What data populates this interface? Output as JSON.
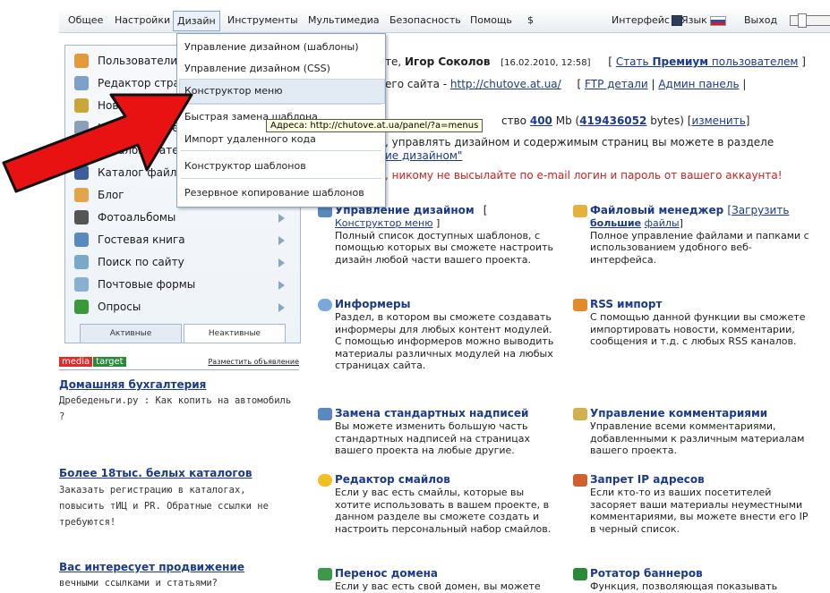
{
  "menubar": {
    "items": [
      "Общее",
      "Настройки",
      "Дизайн",
      "Инструменты",
      "Мультимедиа",
      "Безопасность",
      "Помощь",
      "$"
    ],
    "right": {
      "interface": "Интерфейс",
      "language": "Язык",
      "exit": "Выход"
    }
  },
  "dropdown": {
    "items": [
      "Управление дизайном (шаблоны)",
      "Управление дизайном (CSS)",
      "Конструктор меню",
      "Быстрая замена шаблона",
      "Импорт удаленного кода",
      "Конструктор шаблонов",
      "Резервное копирование шаблонов"
    ],
    "tooltip": "Адреса: http://chutove.at.ua/panel/?a=menus"
  },
  "sidebar": {
    "items": [
      {
        "label": "Пользователи",
        "icon": "users-icon",
        "color": "#e49a3a"
      },
      {
        "label": "Редактор страниц",
        "icon": "page-editor-icon",
        "color": "#7da0c8"
      },
      {
        "label": "Новости",
        "icon": "news-icon",
        "color": "#c9a53a"
      },
      {
        "label": "Каталог статей",
        "icon": "articles-icon",
        "color": "#8aa0b8"
      },
      {
        "label": "Каталог статей",
        "icon": "catalog-icon",
        "color": "#7ea0c4"
      },
      {
        "label": "Каталог файлов",
        "icon": "save-icon",
        "color": "#3a5f9a"
      },
      {
        "label": "Блог",
        "icon": "blog-icon",
        "color": "#e3a54a"
      },
      {
        "label": "Фотоальбомы",
        "icon": "camera-icon",
        "color": "#555555"
      },
      {
        "label": "Гостевая книга",
        "icon": "book-icon",
        "color": "#5a89c0"
      },
      {
        "label": "Поиск по сайту",
        "icon": "search-icon",
        "color": "#7aa8c8"
      },
      {
        "label": "Почтовые формы",
        "icon": "mail-icon",
        "color": "#8ab0d0"
      },
      {
        "label": "Опросы",
        "icon": "chart-icon",
        "color": "#3a9a3a"
      }
    ],
    "tabs": {
      "active": "Активные",
      "inactive": "Неактивные"
    }
  },
  "ad": {
    "brand1": "media",
    "brand2": "target",
    "place": "Разместить объявление",
    "blocks": [
      {
        "title": "Домашняя бухгалтерия",
        "text": "Дребеденьги.ру : Как копить на автомобиль ?"
      },
      {
        "title": "Более 18тыс. белых каталогов",
        "text": "Заказать регистрацию в каталогах, повысить тИЦ и PR. Обратные ссылки не требуются!"
      },
      {
        "title": "Вас интересует продвижение",
        "text": "вечными ссылками и статьями?"
      }
    ]
  },
  "welcome": {
    "greet": "те,",
    "name": "Игор Соколов",
    "datetime": "[16.02.2010, 12:58]",
    "premium_pre": "[",
    "premium_link1": "Стать",
    "premium_link2": "Премиум",
    "premium_link3": "пользователем",
    "premium_post": "]",
    "site_pre": "его сайта - ",
    "site_url": "http://chutove.at.ua/",
    "ftp_link": "FTP детали",
    "sep": "|",
    "admin_link": "Админ панель",
    "storage_pre": "ство",
    "storage_mb": "400",
    "storage_unit": "Mb (",
    "storage_bytes": "419436052",
    "storage_bytes_unit": "bytes)",
    "storage_change": "изменить",
    "design_line1": ", управлять дизайном и содержимым страниц вы можете в разделе",
    "design_line2": "ие дизайном\"",
    "warning": ", никому не высылайте по e-mail логин и пароль от вашего аккаунта!"
  },
  "sections": [
    {
      "title": "Управление дизайном",
      "extra": "[",
      "link": "Конструктор меню",
      "close": "]",
      "desc": "Полный список доступных шаблонов, с помощью которых вы сможете настроить дизайн любой части вашего проекта.",
      "icon": "design-icon",
      "color": "#5a89c0"
    },
    {
      "title": "Файловый менеджер",
      "extra": "[",
      "link": "Загрузить",
      "link2": "большие",
      "link3": "файлы",
      "close": "]",
      "desc": "Полное управление файлами и папками с использованием удобного веб-интерфейса.",
      "icon": "folder-icon",
      "color": "#e4b23a"
    },
    {
      "title": "Информеры",
      "desc": "Раздел, в котором вы сможете создавать информеры для любых контент модулей. С помощью информеров можно выводить материалы различных модулей на любых страницах сайта.",
      "icon": "informer-icon",
      "color": "#7aa8d8"
    },
    {
      "title": "RSS импорт",
      "desc": "С помощью данной функции вы сможете импортировать новости, комментарии, сообщения и т.д. с любых RSS каналов.",
      "icon": "rss-icon",
      "color": "#e38a2a"
    },
    {
      "title": "Замена стандартных надписей",
      "desc": "Вы можете изменить большую часть стандартных надписей на страницах вашего проекта на любые другие.",
      "icon": "replace-icon",
      "color": "#5a89c0"
    },
    {
      "title": "Управление комментариями",
      "desc": "Управление всеми комментариями, добавленными к различным материалам вашего проекта.",
      "icon": "comments-icon",
      "color": "#d0b050"
    },
    {
      "title": "Редактор смайлов",
      "desc": "Если у вас есть смайлы, которые вы хотите использовать в вашем проекте, в данном разделе вы сможете создать и настроить персональный набор смайлов.",
      "icon": "smiley-icon",
      "color": "#f0c020"
    },
    {
      "title": "Запрет IP адресов",
      "desc": "Если кто-то из ваших посетителей засоряет ваши материалы неуместными комментариями, вы можете внести его IP в черный список.",
      "icon": "ip-ban-icon",
      "color": "#d06030"
    },
    {
      "title": "Перенос домена",
      "desc": "Если у вас есть свой домен, вы можете",
      "icon": "domain-icon",
      "color": "#3a9a4a"
    },
    {
      "title": "Ротатор баннеров",
      "desc": "Функция, позволяющая показывать",
      "icon": "banner-icon",
      "color": "#2a8a3a"
    }
  ]
}
